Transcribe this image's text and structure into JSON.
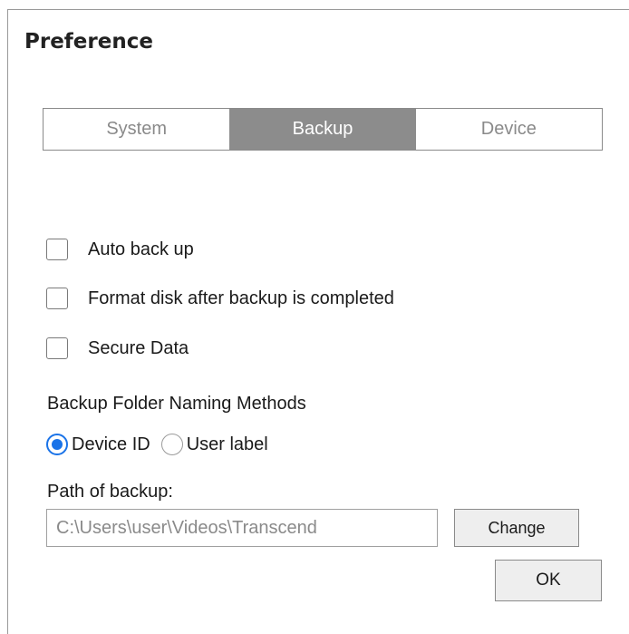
{
  "dialog": {
    "title": "Preference"
  },
  "tabs": [
    {
      "label": "System",
      "active": false
    },
    {
      "label": "Backup",
      "active": true
    },
    {
      "label": "Device",
      "active": false
    }
  ],
  "options": {
    "auto_backup": {
      "label": "Auto back up",
      "checked": false
    },
    "format_disk": {
      "label": "Format disk after backup is completed",
      "checked": false
    },
    "secure_data": {
      "label": "Secure Data",
      "checked": false
    }
  },
  "naming": {
    "heading": "Backup Folder Naming Methods",
    "device_id": {
      "label": "Device ID",
      "selected": true
    },
    "user_label": {
      "label": "User label",
      "selected": false
    }
  },
  "path": {
    "label": "Path of backup:",
    "value": "C:\\Users\\user\\Videos\\Transcend",
    "change_label": "Change"
  },
  "ok_label": "OK",
  "colors": {
    "accent": "#1a73e8",
    "active_tab": "#8c8c8c"
  }
}
